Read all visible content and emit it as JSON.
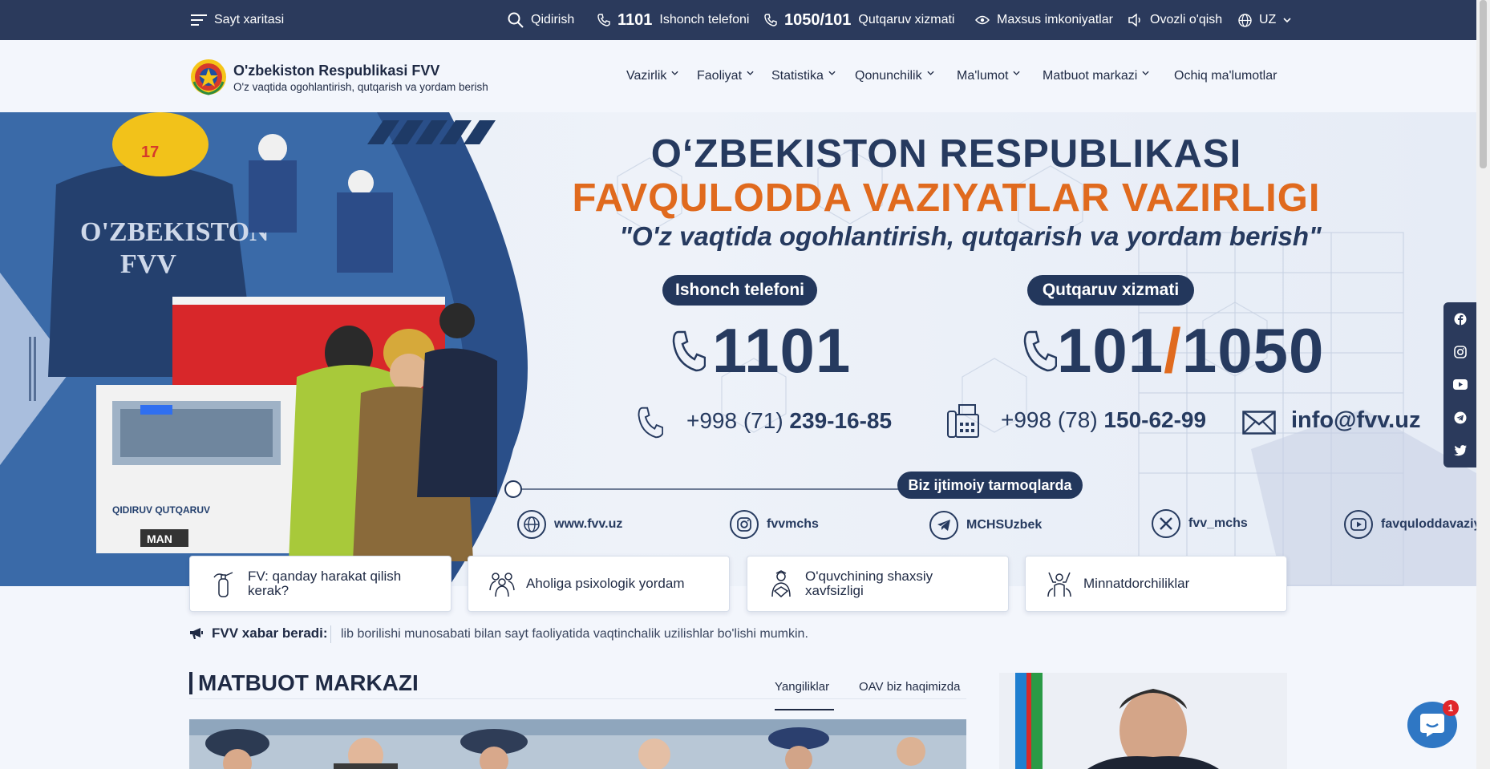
{
  "topbar": {
    "site_map": "Sayt xaritasi",
    "search": "Qidirish",
    "hotline_number": "1101",
    "hotline_label": "Ishonch telefoni",
    "rescue_number": "1050/101",
    "rescue_label": "Qutqaruv xizmati",
    "accessibility": "Maxsus imkoniyatlar",
    "voice": "Ovozli o'qish",
    "language": "UZ"
  },
  "header": {
    "org_name": "O'zbekiston Respublikasi FVV",
    "org_subtitle": "O'z vaqtida ogohlantirish, qutqarish va yordam berish",
    "nav": [
      "Vazirlik",
      "Faoliyat",
      "Statistika",
      "Qonunchilik",
      "Ma'lumot",
      "Matbuot markazi",
      "Ochiq ma'lumotlar"
    ]
  },
  "hero": {
    "title_line1": "O‘ZBEKISTON RESPUBLIKASI",
    "title_line2": "FAVQULODDA VAZIYATLAR VAZIRLIGI",
    "motto": "\"O'z vaqtida ogohlantirish, qutqarish va yordam berish\"",
    "trust_pill": "Ishonch telefoni",
    "rescue_pill": "Qutqaruv xizmati",
    "trust_number": "1101",
    "rescue_number_a": "101",
    "rescue_slash": "/",
    "rescue_number_b": "1050",
    "phone1_prefix": "+998 (71) ",
    "phone1_main": "239-16-85",
    "phone2_prefix": "+998 (78) ",
    "phone2_main": "150-62-99",
    "email": "info@fvv.uz",
    "social_pill": "Biz ijtimoiy tarmoqlarda",
    "social": [
      "www.fvv.uz",
      "fvvmchs",
      "MCHSUzbek",
      "fvv_mchs",
      "favquloddavaziy..."
    ],
    "helmet_number": "17",
    "jacket_text": "O'ZBEKISTON FVV",
    "truck_text": "QIDIRUV QUTQARUV XIZMATI",
    "truck_brand": "MAN"
  },
  "quick_links": [
    "FV: qanday harakat qilish kerak?",
    "Aholiga psixologik yordam",
    "O'quvchining shaxsiy xavfsizligi",
    "Minnatdorchiliklar"
  ],
  "ticker": {
    "label": "FVV xabar beradi:",
    "text": "lib borilishi munosabati bilan sayt faoliyatida vaqtinchalik uzilishlar bo'lishi mumkin."
  },
  "press": {
    "title": "MATBUOT MARKAZI",
    "tabs": [
      "Yangiliklar",
      "OAV biz haqimizda"
    ]
  },
  "chat": {
    "badge": "1"
  },
  "colors": {
    "navy": "#2b3a5c",
    "orange": "#e06a1e",
    "text": "#1f2a44"
  }
}
